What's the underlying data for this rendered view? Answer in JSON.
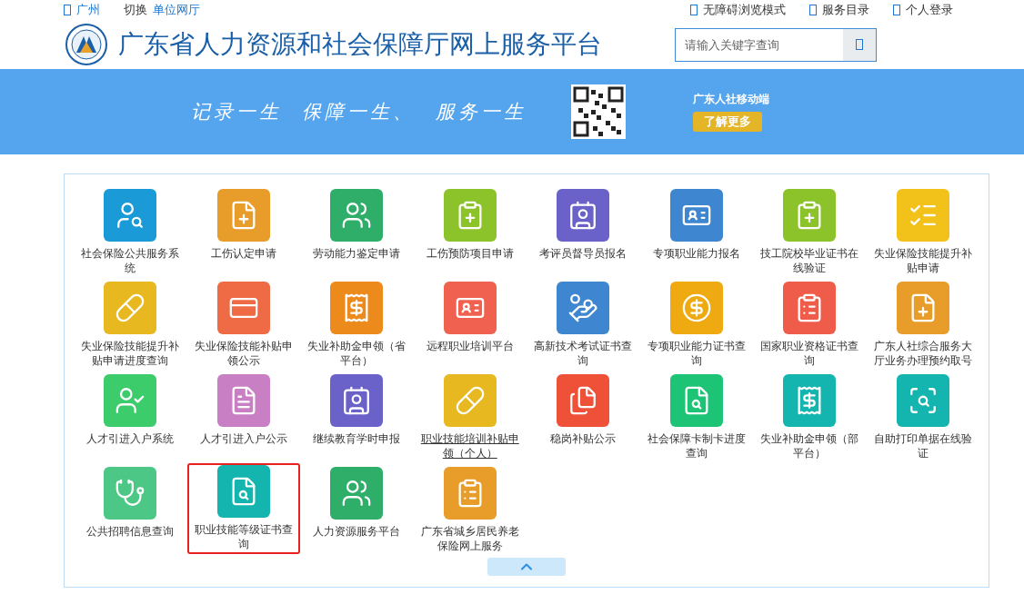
{
  "top_bar": {
    "city": "广州",
    "switch": "切换",
    "unit_hall": "单位网厅",
    "links": [
      "无障碍浏览模式",
      "服务目录",
      "个人登录"
    ]
  },
  "header": {
    "title": "广东省人力资源和社会保障厅网上服务平台",
    "search": {
      "placeholder": "请输入关键字查询"
    }
  },
  "banner": {
    "slogans": [
      "记录一生",
      "保障一生、",
      "服务一生"
    ],
    "app_label": "广东人社移动端",
    "more_button": "了解更多"
  },
  "services": [
    {
      "label": "社会保险公共服务系统",
      "color": "#1a9ad6",
      "highlighted": false,
      "hovered": false
    },
    {
      "label": "工伤认定申请",
      "color": "#e89c2a",
      "highlighted": false,
      "hovered": false
    },
    {
      "label": "劳动能力鉴定申请",
      "color": "#2fae6a",
      "highlighted": false,
      "hovered": false
    },
    {
      "label": "工伤预防项目申请",
      "color": "#8cc22a",
      "highlighted": false,
      "hovered": false
    },
    {
      "label": "考评员督导员报名",
      "color": "#6a62c8",
      "highlighted": false,
      "hovered": false
    },
    {
      "label": "专项职业能力报名",
      "color": "#3e86cf",
      "highlighted": false,
      "hovered": false
    },
    {
      "label": "技工院校毕业证书在线验证",
      "color": "#8cc22a",
      "highlighted": false,
      "hovered": false
    },
    {
      "label": "失业保险技能提升补贴申请",
      "color": "#f2c21b",
      "highlighted": false,
      "hovered": false
    },
    {
      "label": "失业保险技能提升补贴申请进度查询",
      "color": "#e8b820",
      "highlighted": false,
      "hovered": false
    },
    {
      "label": "失业保险技能补贴申领公示",
      "color": "#ee6b45",
      "highlighted": false,
      "hovered": false
    },
    {
      "label": "失业补助金申领（省平台）",
      "color": "#ec8a1c",
      "highlighted": false,
      "hovered": false
    },
    {
      "label": "远程职业培训平台",
      "color": "#f0614f",
      "highlighted": false,
      "hovered": false
    },
    {
      "label": "高新技术考试证书查询",
      "color": "#3e86cf",
      "highlighted": false,
      "hovered": false
    },
    {
      "label": "专项职业能力证书查询",
      "color": "#eeaa10",
      "highlighted": false,
      "hovered": false
    },
    {
      "label": "国家职业资格证书查询",
      "color": "#ef5d4a",
      "highlighted": false,
      "hovered": false
    },
    {
      "label": "广东人社综合服务大厅业务办理预约取号",
      "color": "#e89c2a",
      "highlighted": false,
      "hovered": false
    },
    {
      "label": "人才引进入户系统",
      "color": "#3dcc6b",
      "highlighted": false,
      "hovered": false
    },
    {
      "label": "人才引进入户公示",
      "color": "#c87fc4",
      "highlighted": false,
      "hovered": false
    },
    {
      "label": "继续教育学时申报",
      "color": "#6a62c8",
      "highlighted": false,
      "hovered": false
    },
    {
      "label": "职业技能培训补贴申领（个人）",
      "color": "#e8b820",
      "highlighted": false,
      "hovered": true
    },
    {
      "label": "稳岗补贴公示",
      "color": "#ee5138",
      "highlighted": false,
      "hovered": false
    },
    {
      "label": "社会保障卡制卡进度查询",
      "color": "#1dc476",
      "highlighted": false,
      "hovered": false
    },
    {
      "label": "失业补助金申领（部平台）",
      "color": "#14b5ae",
      "highlighted": false,
      "hovered": false
    },
    {
      "label": "自助打印单据在线验证",
      "color": "#14b5ae",
      "highlighted": false,
      "hovered": false
    },
    {
      "label": "公共招聘信息查询",
      "color": "#4dc786",
      "highlighted": false,
      "hovered": false
    },
    {
      "label": "职业技能等级证书查询",
      "color": "#14b5ae",
      "highlighted": true,
      "hovered": false
    },
    {
      "label": "人力资源服务平台",
      "color": "#2fae6a",
      "highlighted": false,
      "hovered": false
    },
    {
      "label": "广东省城乡居民养老保险网上服务",
      "color": "#e89c2a",
      "highlighted": false,
      "hovered": false
    }
  ]
}
